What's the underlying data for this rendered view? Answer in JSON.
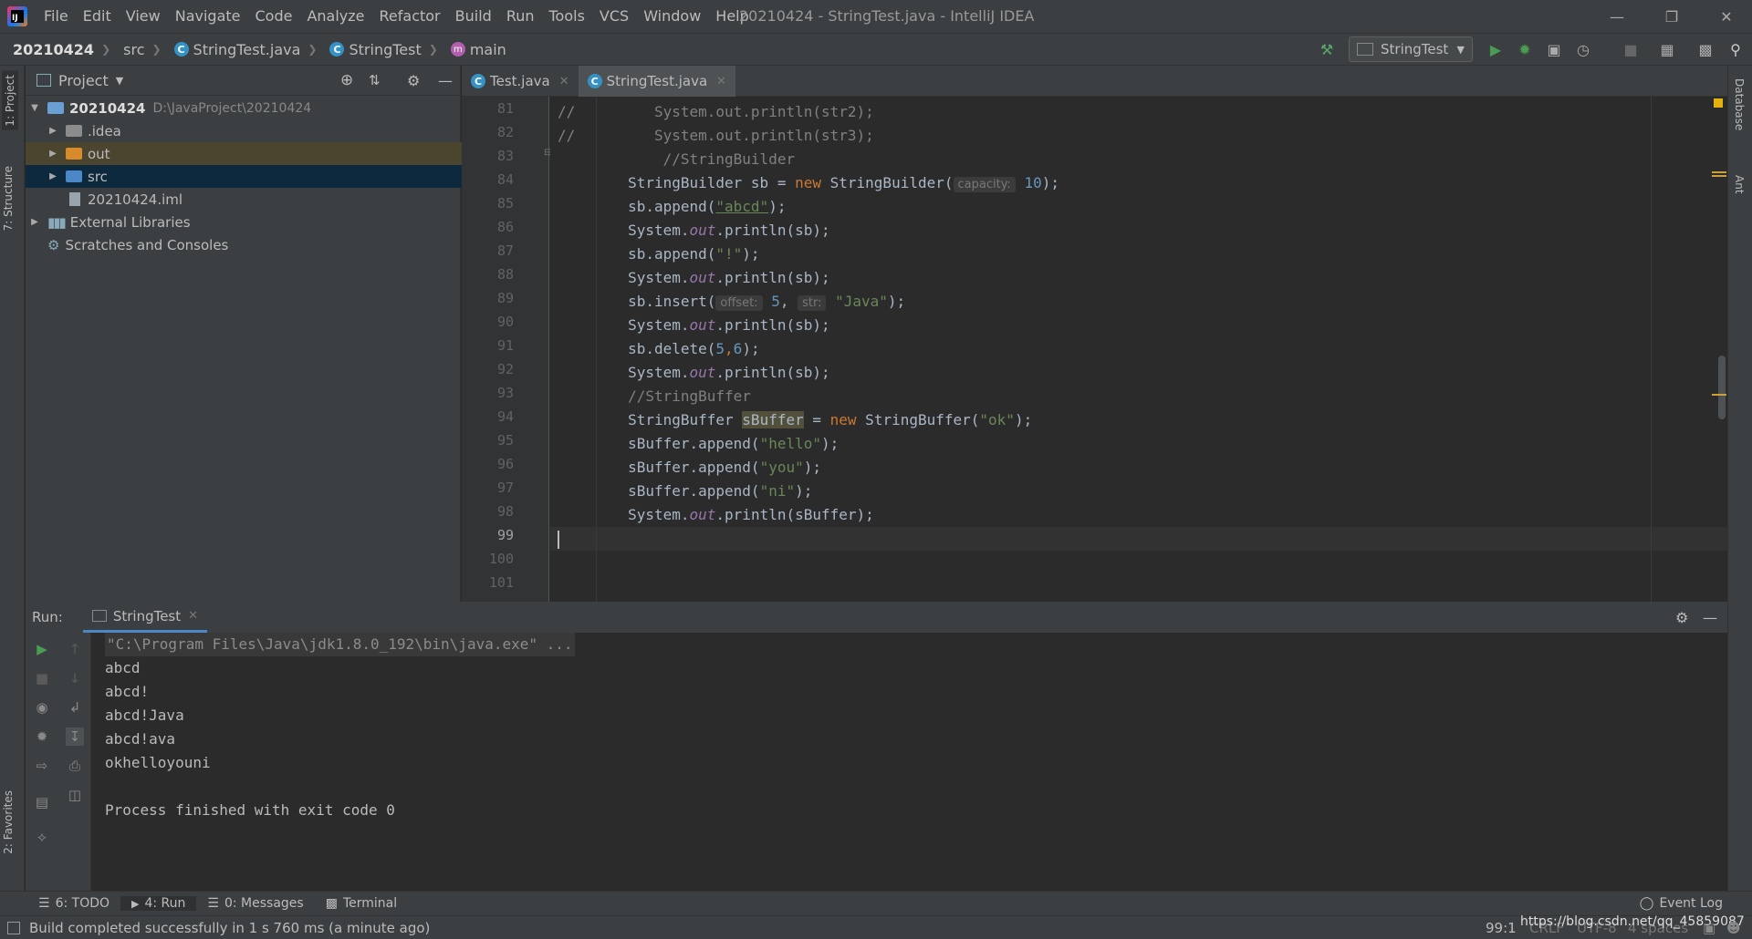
{
  "menu": [
    "File",
    "Edit",
    "View",
    "Navigate",
    "Code",
    "Analyze",
    "Refactor",
    "Build",
    "Run",
    "Tools",
    "VCS",
    "Window",
    "Help"
  ],
  "window_title": "20210424 - StringTest.java - IntelliJ IDEA",
  "breadcrumb": {
    "project": "20210424",
    "src": "src",
    "file": "StringTest.java",
    "class": "StringTest",
    "method": "main"
  },
  "run_config": "StringTest",
  "project_panel": {
    "title": "Project",
    "root_name": "20210424",
    "root_path": "D:\\JavaProject\\20210424",
    "items": [
      ".idea",
      "out",
      "src",
      "20210424.iml"
    ],
    "external": "External Libraries",
    "scratches": "Scratches and Consoles"
  },
  "left_tabs": {
    "project": "1: Project",
    "structure": "7: Structure",
    "favorites": "2: Favorites"
  },
  "right_tabs": {
    "database": "Database",
    "ant": "Ant"
  },
  "editor_tabs": [
    "Test.java",
    "StringTest.java"
  ],
  "line_numbers": [
    "81",
    "82",
    "83",
    "84",
    "85",
    "86",
    "87",
    "88",
    "89",
    "90",
    "91",
    "92",
    "93",
    "94",
    "95",
    "96",
    "97",
    "98",
    "99",
    "100",
    "101"
  ],
  "code": {
    "l81a": "//",
    "l81b": "System.out.println(str2);",
    "l82a": "//",
    "l82b": "System.out.println(str3);",
    "l83": "//StringBuilder",
    "l84a": "StringBuilder sb = ",
    "l84kw": "new",
    "l84b": " StringBuilder(",
    "l84hint": "capacity:",
    "l84num": "10",
    "l84c": ");",
    "l85a": "sb.append(",
    "l85str": "\"abcd\"",
    "l85b": ");",
    "l86a": "System.",
    "l86it": "out",
    "l86b": ".println(sb);",
    "l87a": "sb.append(",
    "l87str": "\"!\"",
    "l87b": ");",
    "l88a": "System.",
    "l88it": "out",
    "l88b": ".println(sb);",
    "l89a": "sb.insert(",
    "l89hint1": "offset:",
    "l89num": "5",
    "l89comma": ", ",
    "l89hint2": "str:",
    "l89str": "\"Java\"",
    "l89b": ");",
    "l90a": "System.",
    "l90it": "out",
    "l90b": ".println(sb);",
    "l91a": "sb.delete(",
    "l91n1": "5",
    "l91comma": ",",
    "l91n2": "6",
    "l91b": ");",
    "l92a": "System.",
    "l92it": "out",
    "l92b": ".println(sb);",
    "l93": "//StringBuffer",
    "l94a": "StringBuffer ",
    "l94var": "sBuffer",
    "l94b": " = ",
    "l94kw": "new",
    "l94c": " StringBuffer(",
    "l94str": "\"ok\"",
    "l94d": ");",
    "l95a": "sBuffer.append(",
    "l95str": "\"hello\"",
    "l95b": ");",
    "l96a": "sBuffer.append(",
    "l96str": "\"you\"",
    "l96b": ");",
    "l97a": "sBuffer.append(",
    "l97str": "\"ni\"",
    "l97b": ");",
    "l98a": "System.",
    "l98it": "out",
    "l98b": ".println(sBuffer);"
  },
  "run_panel": {
    "label": "Run:",
    "tab": "StringTest",
    "output": [
      "\"C:\\Program Files\\Java\\jdk1.8.0_192\\bin\\java.exe\" ...",
      "abcd",
      "abcd!",
      "abcd!Java",
      "abcd!ava",
      "okhelloyouni",
      "",
      "Process finished with exit code 0"
    ]
  },
  "bottom_tabs": {
    "todo": "6: TODO",
    "run": "4: Run",
    "messages": "0: Messages",
    "terminal": "Terminal",
    "event_log": "Event Log"
  },
  "status": {
    "message": "Build completed successfully in 1 s 760 ms (a minute ago)",
    "position": "99:1",
    "line_sep": "CRLF",
    "encoding": "UTF-8",
    "indent": "4 spaces",
    "watermark": "https://blog.csdn.net/qq_45859087"
  },
  "colors": {
    "accent": "#4a88c7",
    "selection": "#0d293e",
    "run_green": "#499c54"
  }
}
